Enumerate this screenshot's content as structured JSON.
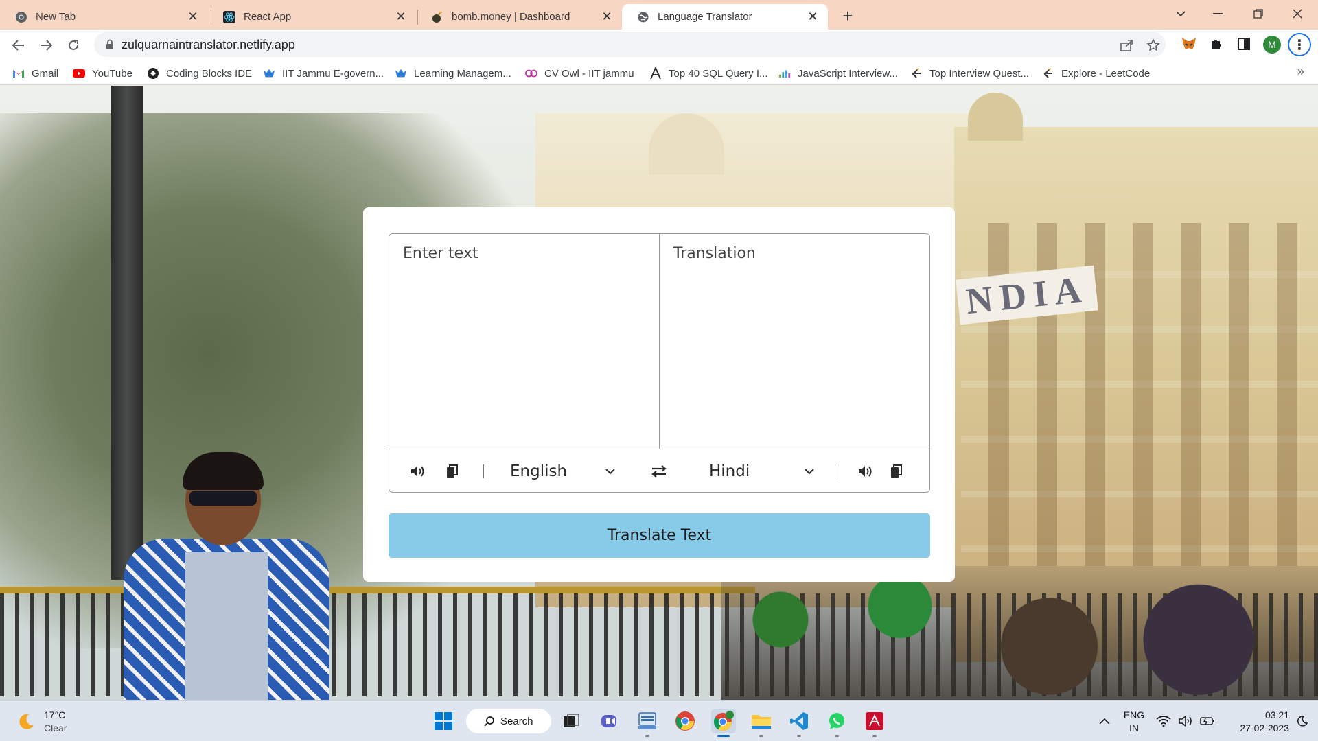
{
  "browser": {
    "tabs": [
      {
        "title": "New Tab",
        "icon": "chrome-icon",
        "active": false
      },
      {
        "title": "React App",
        "icon": "react-icon",
        "active": false
      },
      {
        "title": "bomb.money | Dashboard",
        "icon": "bomb-icon",
        "active": false
      },
      {
        "title": "Language Translator",
        "icon": "globe-icon",
        "active": true
      }
    ],
    "url": "zulquarnaintranslator.netlify.app",
    "profile_initial": "M",
    "bookmarks": [
      {
        "label": "Gmail",
        "icon": "gmail-icon"
      },
      {
        "label": "YouTube",
        "icon": "youtube-icon"
      },
      {
        "label": "Coding Blocks IDE",
        "icon": "codingblocks-icon"
      },
      {
        "label": "IIT Jammu E-govern...",
        "icon": "iitj-icon"
      },
      {
        "label": "Learning Managem...",
        "icon": "iitj-icon"
      },
      {
        "label": "CV Owl - IIT jammu",
        "icon": "owl-icon"
      },
      {
        "label": "Top 40 SQL Query I...",
        "icon": "a-letter-icon"
      },
      {
        "label": "JavaScript Interview...",
        "icon": "chart-icon"
      },
      {
        "label": "Top Interview Quest...",
        "icon": "leetcode-icon"
      },
      {
        "label": "Explore - LeetCode",
        "icon": "leetcode-icon"
      }
    ]
  },
  "page": {
    "background_sign": "NDIA",
    "translator": {
      "from_placeholder": "Enter text",
      "to_placeholder": "Translation",
      "from_language": "English",
      "to_language": "Hindi",
      "button_label": "Translate Text",
      "button_color": "#87cbe9"
    }
  },
  "taskbar": {
    "weather_temp": "17°C",
    "weather_desc": "Clear",
    "search_label": "Search",
    "lang_top": "ENG",
    "lang_bottom": "IN",
    "time": "03:21",
    "date": "27-02-2023"
  }
}
